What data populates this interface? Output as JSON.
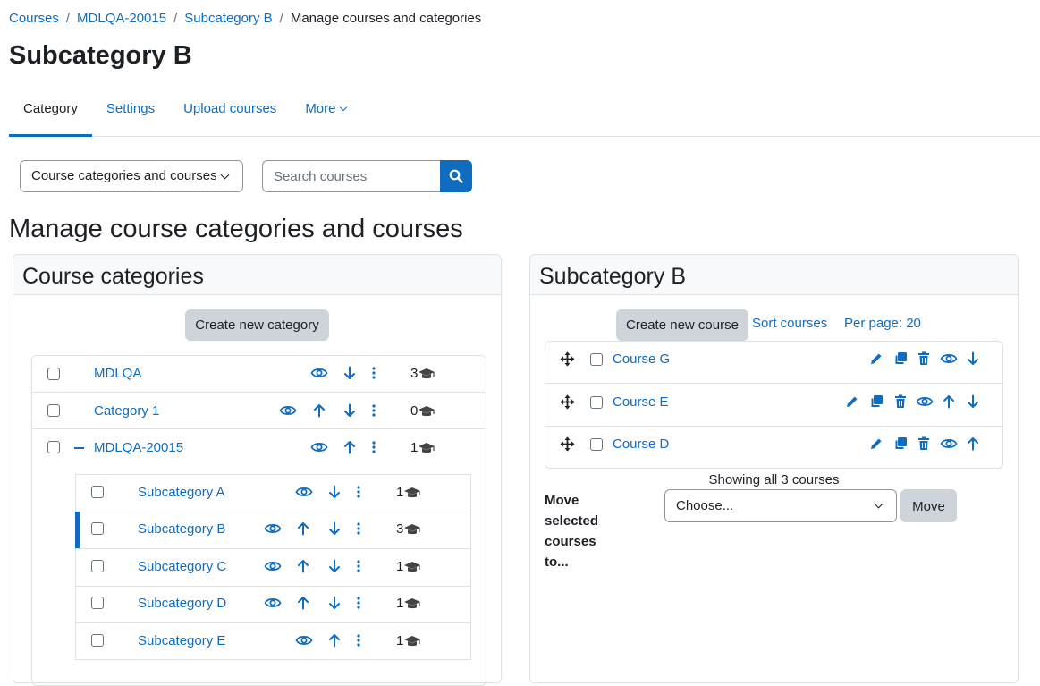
{
  "breadcrumb": {
    "items": [
      "Courses",
      "MDLQA-20015",
      "Subcategory B"
    ],
    "current": "Manage courses and categories",
    "separator": "/"
  },
  "page_title": "Subcategory B",
  "tabs": [
    {
      "label": "Category",
      "active": true
    },
    {
      "label": "Settings"
    },
    {
      "label": "Upload courses"
    },
    {
      "label": "More"
    }
  ],
  "view_select": {
    "value": "Course categories and courses"
  },
  "search": {
    "placeholder": "Search courses"
  },
  "section_title": "Manage course categories and courses",
  "categories_panel": {
    "title": "Course categories",
    "create_label": "Create new category",
    "top_categories": [
      {
        "name": "MDLQA",
        "count": "3"
      },
      {
        "name": "Category 1",
        "count": "0"
      },
      {
        "name": "MDLQA-20015",
        "count": "1"
      }
    ],
    "subcategories": [
      {
        "name": "Subcategory A",
        "count": "1"
      },
      {
        "name": "Subcategory B",
        "count": "3"
      },
      {
        "name": "Subcategory C",
        "count": "1"
      },
      {
        "name": "Subcategory D",
        "count": "1"
      },
      {
        "name": "Subcategory E",
        "count": "1"
      }
    ]
  },
  "courses_panel": {
    "title": "Subcategory B",
    "create_label": "Create new course",
    "sort_label": "Sort courses",
    "per_page_label": "Per page: 20",
    "courses": [
      {
        "name": "Course G"
      },
      {
        "name": "Course E"
      },
      {
        "name": "Course D"
      }
    ],
    "showing": "Showing all 3 courses",
    "move_label": "Move selected courses to...",
    "move_select_value": "Choose...",
    "move_button": "Move"
  },
  "colors": {
    "accent": "#0f6cbf",
    "button_grey": "#ced4da"
  }
}
